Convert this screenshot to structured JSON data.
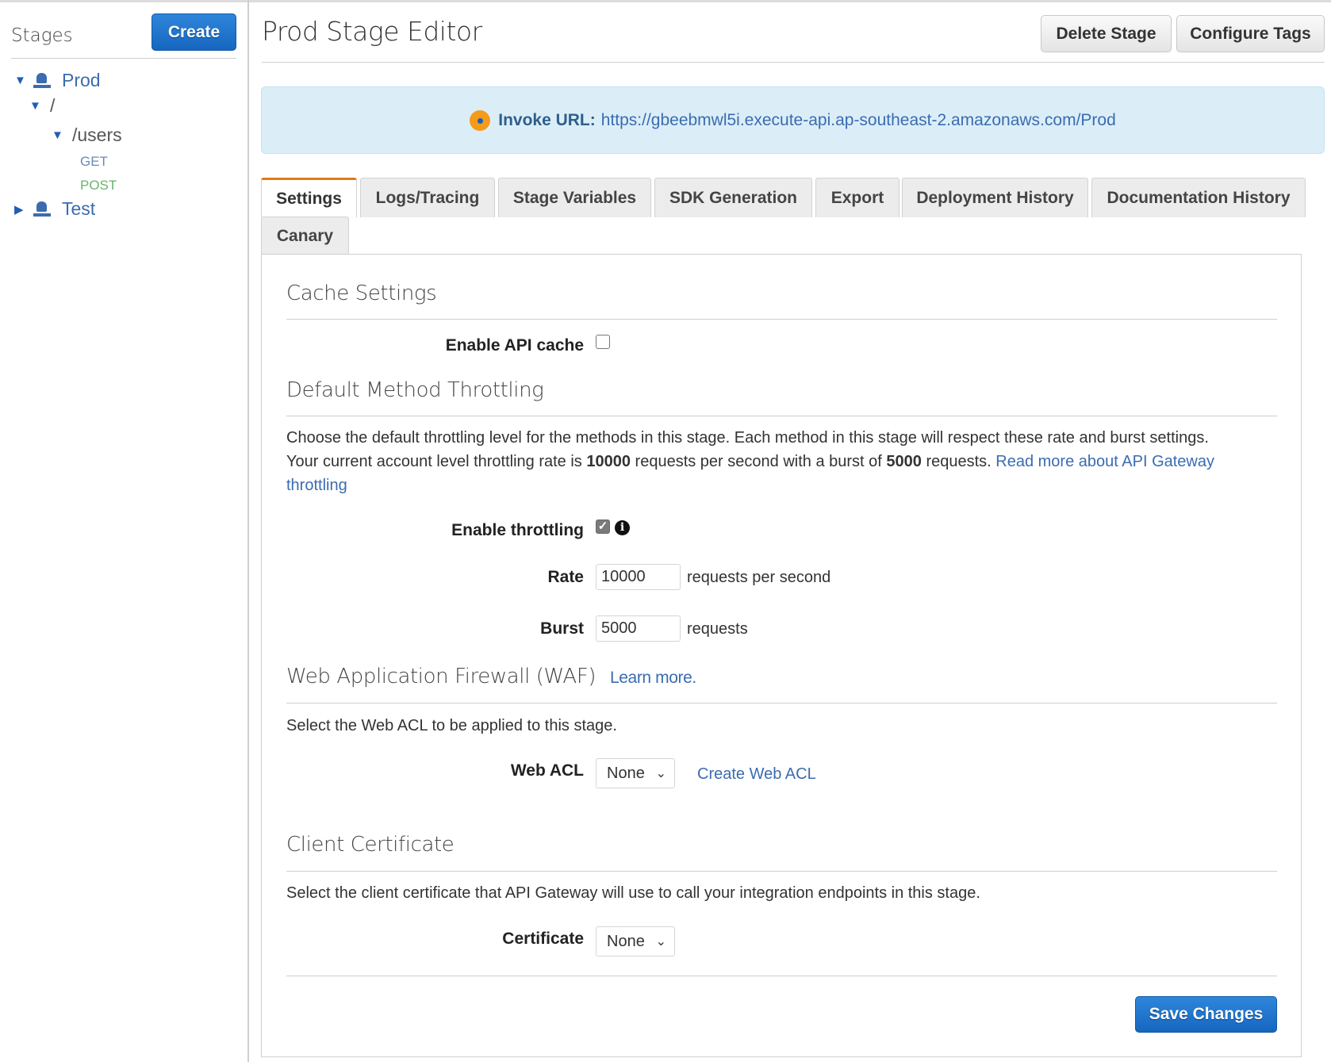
{
  "sidebar": {
    "title": "Stages",
    "create_label": "Create",
    "tree": {
      "prod": "Prod",
      "root": "/",
      "users": "/users",
      "get": "GET",
      "post": "POST",
      "test": "Test"
    }
  },
  "header": {
    "title": "Prod Stage Editor",
    "delete_label": "Delete Stage",
    "tags_label": "Configure Tags"
  },
  "invoke": {
    "label": "Invoke URL:",
    "url": "https://gbeebmwl5i.execute-api.ap-southeast-2.amazonaws.com/Prod"
  },
  "tabs": [
    {
      "label": "Settings",
      "active": true
    },
    {
      "label": "Logs/Tracing"
    },
    {
      "label": "Stage Variables"
    },
    {
      "label": "SDK Generation"
    },
    {
      "label": "Export"
    },
    {
      "label": "Deployment History"
    },
    {
      "label": "Documentation History"
    },
    {
      "label": "Canary"
    }
  ],
  "cache": {
    "title": "Cache Settings",
    "enable_label": "Enable API cache",
    "enabled": false
  },
  "throttling": {
    "title": "Default Method Throttling",
    "desc_line1": "Choose the default throttling level for the methods in this stage. Each method in this stage will respect these rate and burst settings.",
    "desc_pre": "Your current account level throttling rate is ",
    "rate_bold": "10000",
    "desc_mid": " requests per second with a burst of ",
    "burst_bold": "5000",
    "desc_post": " requests. ",
    "read_more_a": "Read more about API Gateway",
    "read_more_b": "throttling",
    "enable_label": "Enable throttling",
    "enabled": true,
    "rate_label": "Rate",
    "rate_value": "10000",
    "rate_unit": "requests per second",
    "burst_label": "Burst",
    "burst_value": "5000",
    "burst_unit": "requests"
  },
  "waf": {
    "title": "Web Application Firewall (WAF)",
    "learn_more": "Learn more.",
    "desc": "Select the Web ACL to be applied to this stage.",
    "acl_label": "Web ACL",
    "acl_value": "None",
    "create_link": "Create Web ACL"
  },
  "cert": {
    "title": "Client Certificate",
    "desc": "Select the client certificate that API Gateway will use to call your integration endpoints in this stage.",
    "label": "Certificate",
    "value": "None"
  },
  "footer": {
    "save_label": "Save Changes"
  }
}
